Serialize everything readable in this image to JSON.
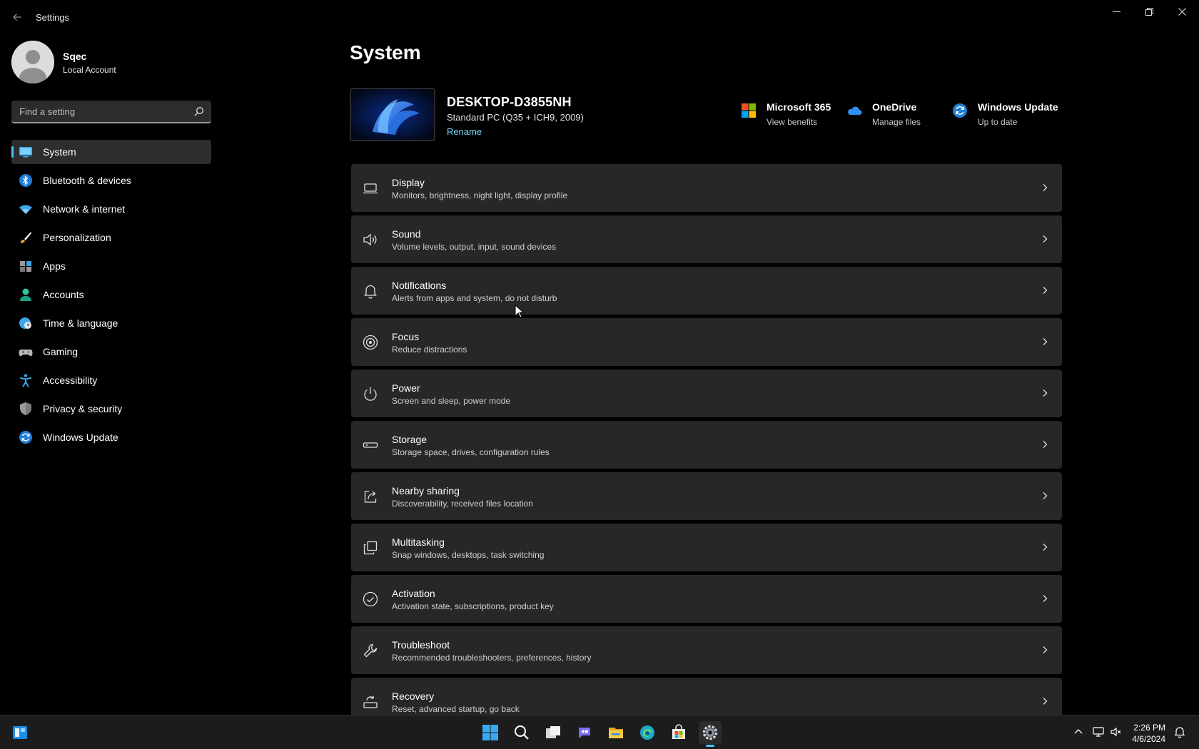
{
  "window": {
    "title": "Settings"
  },
  "profile": {
    "name": "Sqec",
    "account_type": "Local Account"
  },
  "search": {
    "placeholder": "Find a setting"
  },
  "sidebar": {
    "items": [
      {
        "label": "System",
        "icon": "monitor-icon",
        "active": true
      },
      {
        "label": "Bluetooth & devices",
        "icon": "bluetooth-icon"
      },
      {
        "label": "Network & internet",
        "icon": "wifi-icon"
      },
      {
        "label": "Personalization",
        "icon": "brush-icon"
      },
      {
        "label": "Apps",
        "icon": "apps-icon"
      },
      {
        "label": "Accounts",
        "icon": "person-icon"
      },
      {
        "label": "Time & language",
        "icon": "globe-clock-icon"
      },
      {
        "label": "Gaming",
        "icon": "gamepad-icon"
      },
      {
        "label": "Accessibility",
        "icon": "accessibility-icon"
      },
      {
        "label": "Privacy & security",
        "icon": "shield-icon"
      },
      {
        "label": "Windows Update",
        "icon": "update-icon"
      }
    ]
  },
  "main": {
    "title": "System",
    "device": {
      "name": "DESKTOP-D3855NH",
      "model": "Standard PC (Q35 + ICH9, 2009)",
      "rename_label": "Rename"
    },
    "quick_links": [
      {
        "title": "Microsoft 365",
        "subtitle": "View benefits",
        "icon": "microsoft-logo-icon"
      },
      {
        "title": "OneDrive",
        "subtitle": "Manage files",
        "icon": "cloud-icon"
      },
      {
        "title": "Windows Update",
        "subtitle": "Up to date",
        "icon": "update-icon"
      }
    ],
    "cards": [
      {
        "title": "Display",
        "subtitle": "Monitors, brightness, night light, display profile",
        "icon": "laptop-icon"
      },
      {
        "title": "Sound",
        "subtitle": "Volume levels, output, input, sound devices",
        "icon": "speaker-icon"
      },
      {
        "title": "Notifications",
        "subtitle": "Alerts from apps and system, do not disturb",
        "icon": "bell-icon"
      },
      {
        "title": "Focus",
        "subtitle": "Reduce distractions",
        "icon": "focus-icon"
      },
      {
        "title": "Power",
        "subtitle": "Screen and sleep, power mode",
        "icon": "power-icon"
      },
      {
        "title": "Storage",
        "subtitle": "Storage space, drives, configuration rules",
        "icon": "drive-icon"
      },
      {
        "title": "Nearby sharing",
        "subtitle": "Discoverability, received files location",
        "icon": "share-icon"
      },
      {
        "title": "Multitasking",
        "subtitle": "Snap windows, desktops, task switching",
        "icon": "multitask-icon"
      },
      {
        "title": "Activation",
        "subtitle": "Activation state, subscriptions, product key",
        "icon": "check-circle-icon"
      },
      {
        "title": "Troubleshoot",
        "subtitle": "Recommended troubleshooters, preferences, history",
        "icon": "wrench-icon"
      },
      {
        "title": "Recovery",
        "subtitle": "Reset, advanced startup, go back",
        "icon": "recovery-icon"
      }
    ]
  },
  "taskbar": {
    "time": "2:26 PM",
    "date": "4/6/2024",
    "apps": [
      "start-icon",
      "search-icon",
      "task-view-icon",
      "chat-icon",
      "file-explorer-icon",
      "edge-icon",
      "store-icon",
      "settings-icon"
    ]
  },
  "colors": {
    "accent": "#4cc2ff",
    "link": "#78d6ff",
    "card": "#272727",
    "background": "#000000"
  }
}
